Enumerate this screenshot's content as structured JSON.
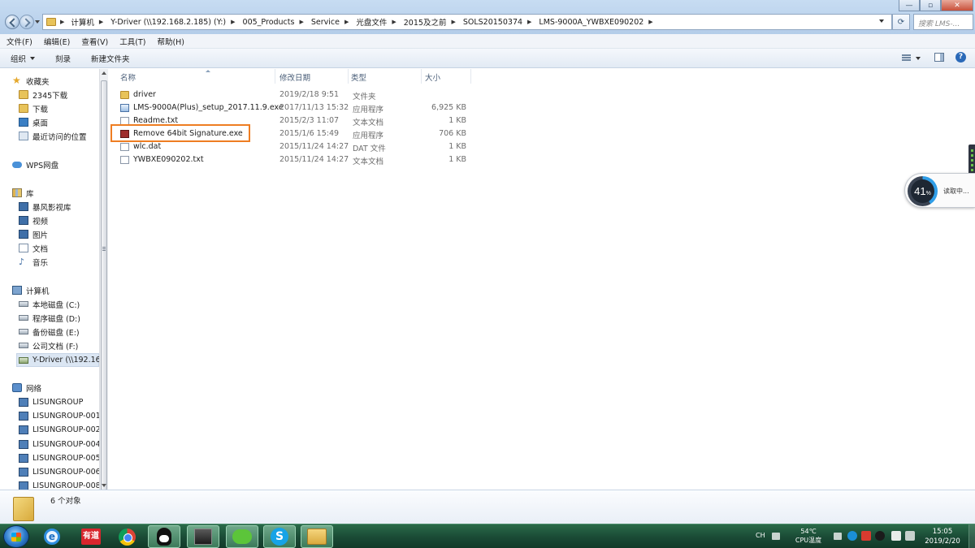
{
  "window": {
    "breadcrumbs": [
      "计算机",
      "Y-Driver (\\\\192.168.2.185) (Y:)",
      "005_Products",
      "Service",
      "光盘文件",
      "2015及之前",
      "SOLS20150374",
      "LMS-9000A_YWBXE090202"
    ],
    "search_placeholder": "搜索 LMS-...",
    "minimize": "—",
    "maximize": "▫",
    "close": "✕",
    "refresh_icon": "refresh-icon"
  },
  "menu": [
    "文件(F)",
    "编辑(E)",
    "查看(V)",
    "工具(T)",
    "帮助(H)"
  ],
  "commands": {
    "organize": "组织",
    "burn": "刻录",
    "new_folder": "新建文件夹"
  },
  "nav": {
    "favorites": {
      "label": "收藏夹",
      "items": [
        "2345下载",
        "下载",
        "桌面",
        "最近访问的位置"
      ]
    },
    "wps": "WPS网盘",
    "libraries": {
      "label": "库",
      "items": [
        "暴风影视库",
        "视频",
        "图片",
        "文档",
        "音乐"
      ]
    },
    "computer": {
      "label": "计算机",
      "items": [
        "本地磁盘 (C:)",
        "程序磁盘 (D:)",
        "备份磁盘 (E:)",
        "公司文档 (F:)",
        "Y-Driver (\\\\192.168"
      ]
    },
    "network": {
      "label": "网络",
      "items": [
        "LISUNGROUP",
        "LISUNGROUP-001",
        "LISUNGROUP-002",
        "LISUNGROUP-004",
        "LISUNGROUP-005",
        "LISUNGROUP-006",
        "LISUNGROUP-008"
      ]
    }
  },
  "columns": {
    "name": "名称",
    "date": "修改日期",
    "type": "类型",
    "size": "大小"
  },
  "files": [
    {
      "name": "driver",
      "date": "2019/2/18 9:51",
      "type": "文件夹",
      "size": "",
      "icon": "folder"
    },
    {
      "name": "LMS-9000A(Plus)_setup_2017.11.9.exe",
      "date": "2017/11/13 15:32",
      "type": "应用程序",
      "size": "6,925 KB",
      "icon": "exe"
    },
    {
      "name": "Readme.txt",
      "date": "2015/2/3 11:07",
      "type": "文本文档",
      "size": "1 KB",
      "icon": "txt"
    },
    {
      "name": "Remove 64bit Signature.exe",
      "date": "2015/1/6 15:49",
      "type": "应用程序",
      "size": "706 KB",
      "icon": "exe-red"
    },
    {
      "name": "wlc.dat",
      "date": "2015/11/24 14:27",
      "type": "DAT 文件",
      "size": "1 KB",
      "icon": "dat"
    },
    {
      "name": "YWBXE090202.txt",
      "date": "2015/11/24 14:27",
      "type": "文本文档",
      "size": "1 KB",
      "icon": "txt"
    }
  ],
  "highlight_color": "#ee7d22",
  "status": {
    "count": "6 个对象"
  },
  "disk_widget": {
    "percent": "41",
    "unit": "%",
    "label": "读取中..."
  },
  "tray": {
    "lang": "CH",
    "temp": "54℃",
    "temp_label": "CPU温度",
    "time": "15:05",
    "date": "2019/2/20"
  },
  "taskbar": {
    "youdao_label": "有道",
    "ie_label": "e",
    "skype_label": "S"
  }
}
